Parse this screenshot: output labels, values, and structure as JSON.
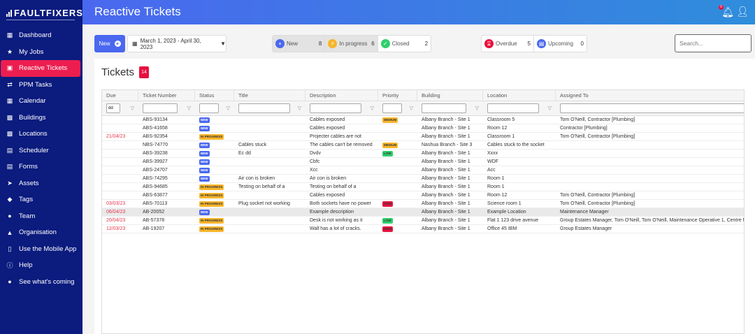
{
  "app": {
    "logo_text_a": "FAULT",
    "logo_text_b": "FIXERS"
  },
  "sidebar": {
    "items": [
      {
        "label": "Dashboard",
        "icon": "grid-icon"
      },
      {
        "label": "My Jobs",
        "icon": "star-icon"
      },
      {
        "label": "Reactive Tickets",
        "icon": "ticket-icon",
        "active": true
      },
      {
        "label": "PPM Tasks",
        "icon": "tasks-icon"
      },
      {
        "label": "Calendar",
        "icon": "calendar-icon"
      },
      {
        "label": "Buildings",
        "icon": "building-icon"
      },
      {
        "label": "Locations",
        "icon": "location-icon"
      },
      {
        "label": "Scheduler",
        "icon": "scheduler-icon"
      },
      {
        "label": "Forms",
        "icon": "forms-icon"
      },
      {
        "label": "Assets",
        "icon": "assets-icon"
      },
      {
        "label": "Tags",
        "icon": "tag-icon"
      },
      {
        "label": "Team",
        "icon": "team-icon"
      },
      {
        "label": "Organisation",
        "icon": "organisation-icon"
      },
      {
        "label": "Use the Mobile App",
        "icon": "mobile-icon"
      },
      {
        "label": "Help",
        "icon": "help-icon"
      },
      {
        "label": "See what's coming",
        "icon": "chat-icon"
      }
    ]
  },
  "header": {
    "title": "Reactive Tickets",
    "notification_count": "0"
  },
  "toolbar": {
    "new_label": "New",
    "date_range": "March 1, 2023 - April 30, 2023",
    "search_placeholder": "Search...",
    "status_filters": [
      {
        "label": "New",
        "count": "8",
        "color": "#4a68ef",
        "selected": true
      },
      {
        "label": "In progress",
        "count": "6",
        "color": "#f7b52a",
        "selected": true
      },
      {
        "label": "Closed",
        "count": "2",
        "color": "#2fcf6b",
        "selected": false
      }
    ],
    "due_filters": [
      {
        "label": "Overdue",
        "count": "5",
        "color": "#e8113f"
      },
      {
        "label": "Upcoming",
        "count": "0",
        "color": "#4a68ef"
      }
    ]
  },
  "tickets": {
    "title": "Tickets",
    "count": "14",
    "columns": [
      "Due",
      "Ticket Number",
      "Status",
      "Title",
      "Description",
      "Priority",
      "Building",
      "Location",
      "Assigned To"
    ],
    "due_filter_value": "dd",
    "rows": [
      [
        "",
        "ABS-93134",
        "NEW",
        "",
        "Cables exposed",
        "MEDIUM",
        "Albany Branch - Site 1",
        "Classroom 5",
        "Tom O'Neill, Contractor [Plumbing]"
      ],
      [
        "",
        "ABS-41658",
        "NEW",
        "",
        "Cables exposed",
        "",
        "Albany Branch - Site 1",
        "Room 12",
        "Contractor [Plumbing]"
      ],
      [
        "21/04/23",
        "ABS-92354",
        "IN PROGRESS",
        "",
        "Projecter cables are not",
        "",
        "Albany Branch - Site 1",
        "Classroom 1",
        "Tom O'Neill, Contractor [Plumbing]"
      ],
      [
        "",
        "NBS-74770",
        "NEW",
        "Cables stuck",
        "The cables can't be removed",
        "MEDIUM",
        "Nashua Branch - Site 3",
        "Cables stuck to the socket",
        ""
      ],
      [
        "",
        "ABS-39238",
        "NEW",
        "Ec dd",
        "Dvdv",
        "LOW",
        "Albany Branch - Site 1",
        "Xxxx",
        ""
      ],
      [
        "",
        "ABS-39927",
        "NEW",
        "",
        "Cbfc",
        "",
        "Albany Branch - Site 1",
        "WDF",
        ""
      ],
      [
        "",
        "ABS-24707",
        "NEW",
        "",
        "Xcc",
        "",
        "Albany Branch - Site 1",
        "Acc",
        ""
      ],
      [
        "",
        "ABS-74295",
        "NEW",
        "Air con is broken",
        "Air con is broken",
        "",
        "Albany Branch - Site 1",
        "Room 1",
        ""
      ],
      [
        "",
        "ABS-94685",
        "IN PROGRESS",
        "Testing on behalf of a",
        "Testing on behalf of a",
        "",
        "Albany Branch - Site 1",
        "Room 1",
        ""
      ],
      [
        "",
        "ABS-63877",
        "IN PROGRESS",
        "",
        "Cables exposed",
        "",
        "Albany Branch - Site 1",
        "Room 12",
        "Tom O'Neill, Contractor [Plumbing]"
      ],
      [
        "03/03/23",
        "ABS-70113",
        "IN PROGRESS",
        "Plug socket not working",
        "Both sockets have no power",
        "HIGH",
        "Albany Branch - Site 1",
        "Science room 1",
        "Tom O'Neill, Contractor [Plumbing]"
      ],
      [
        "06/04/23",
        "AB-20052",
        "NEW",
        "",
        "Example description",
        "",
        "Albany Branch - Site 1",
        "Example Location",
        "Maintenance Manager"
      ],
      [
        "20/04/23",
        "AB-57378",
        "IN PROGRESS",
        "",
        "Desk is not working as it",
        "LOW",
        "Albany Branch - Site 1",
        "Flat 1 123 drive avenue",
        "Group Estates Manager, Tom O'Neill, Tom O'Neill, Maintenance Operative 1, Centre Ma"
      ],
      [
        "12/03/23",
        "AB-19207",
        "IN PROGRESS",
        "",
        "Wall has a lot of cracks.",
        "HIGH",
        "Albany Branch - Site 1",
        "Office 45 IBM",
        "Group Estates Manager"
      ]
    ],
    "highlighted_row": 11
  }
}
